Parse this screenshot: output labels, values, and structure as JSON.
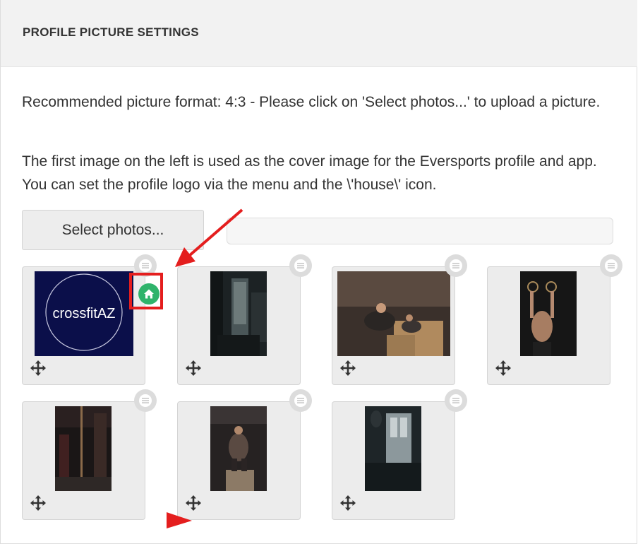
{
  "panel": {
    "title": "PROFILE PICTURE SETTINGS"
  },
  "instructions": {
    "format_note": "Recommended picture format: 4:3 - Please click on 'Select photos...' to upload a picture.",
    "cover_note": "The first image on the left is used as the cover image for the Eversports profile and app. You can set the profile logo via the menu and the \\'house\\' icon."
  },
  "upload": {
    "button_label": "Select photos...",
    "filename_value": ""
  },
  "photos": [
    {
      "description": "crossfitAZ logo",
      "logo_text": "crossfitAZ",
      "is_profile_logo": true
    },
    {
      "description": "dark gym interior"
    },
    {
      "description": "women doing box push exercise"
    },
    {
      "description": "athlete on gymnastic rings"
    },
    {
      "description": "gym with climbing rope"
    },
    {
      "description": "man doing box jump"
    },
    {
      "description": "window light in gym"
    }
  ],
  "colors": {
    "header_bg": "#f2f2f2",
    "tile_bg": "#ececec",
    "home_green": "#2fb36b",
    "annotation_red": "#e41e1e",
    "logo_navy": "#0b0f4a"
  },
  "icons": {
    "menu": "hamburger-icon",
    "home": "house-icon",
    "move": "move-arrows-icon"
  }
}
